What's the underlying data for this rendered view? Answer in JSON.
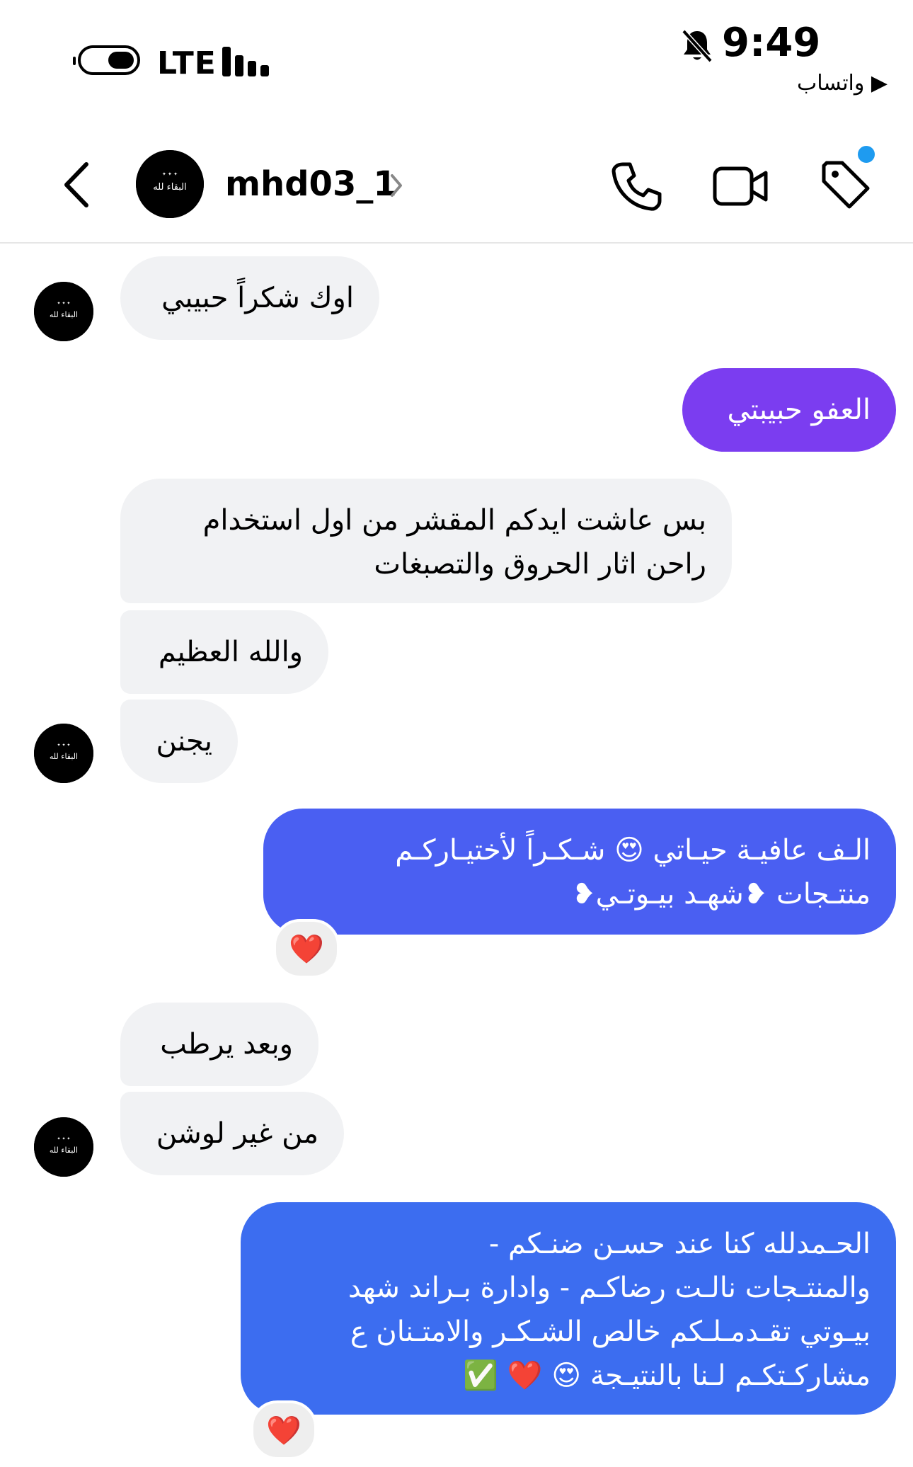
{
  "status_bar": {
    "network": "LTE",
    "time": "9:49",
    "back_to_app": "واتساب",
    "back_arrow": "▶"
  },
  "header": {
    "username": "mhd03_1",
    "avatar_text": "البقاء لله",
    "icons": [
      "back-arrow-icon",
      "chevron-right-icon",
      "phone-icon",
      "video-camera-icon",
      "tag-icon"
    ],
    "notification_dot_color": "#1e9bf0"
  },
  "messages": [
    {
      "side": "in",
      "text": "اوك شكراً حبيبي"
    },
    {
      "side": "out",
      "text": "العفو حبيبتي",
      "color": "#7b3df0"
    },
    {
      "side": "in",
      "text": "بس عاشت ايدكم المقشر من اول استخدام\nراحن اثار الحروق والتصبغات"
    },
    {
      "side": "in",
      "text": "والله العظيم"
    },
    {
      "side": "in",
      "text": "يجنن"
    },
    {
      "side": "out",
      "text": "الـف عافيـة حيـاتي 😍 شـكـراً لأختيـاركـم\nمنتـجات ❥شهـد بيـوتـي❥",
      "color": "#4a5ff2",
      "reaction": "❤️"
    },
    {
      "side": "in",
      "text": "وبعد يرطب"
    },
    {
      "side": "in",
      "text": "من غير لوشن"
    },
    {
      "side": "out",
      "text": "الحـمدلله كنا عند حسـن ضنـكم -\nوالمنتـجات نالـت رضاكـم - وادارة بـراند شهد\nبيـوتي تقـدمـلـكم خالص الشـكـر والامتـنان ع\nمشاركـتكـم لـنا بالنتيـجة 😍 ❤️ ✅",
      "color": "#3c6df0",
      "reaction": "❤️"
    }
  ],
  "avatar_text": "البقاء لله"
}
